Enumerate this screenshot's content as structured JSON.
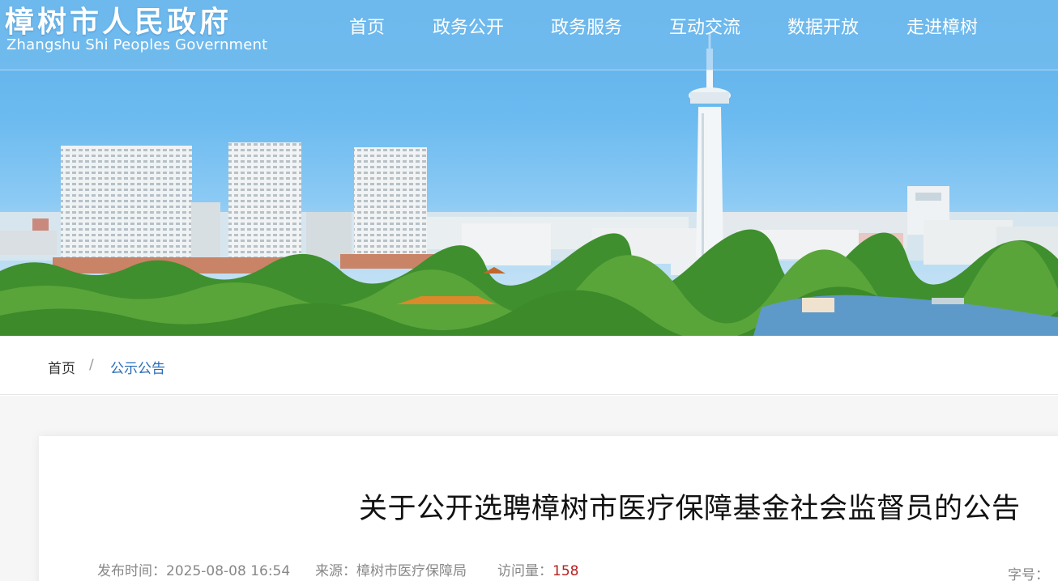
{
  "site": {
    "title_cn": "樟树市人民政府",
    "title_en": "Zhangshu Shi  Peoples Government"
  },
  "nav": {
    "items": [
      {
        "label": "首页"
      },
      {
        "label": "政务公开"
      },
      {
        "label": "政务服务"
      },
      {
        "label": "互动交流"
      },
      {
        "label": "数据开放"
      },
      {
        "label": "走进樟树"
      }
    ]
  },
  "breadcrumb": {
    "home": "首页",
    "separator": "/",
    "current": "公示公告"
  },
  "article": {
    "title": "关于公开选聘樟树市医疗保障基金社会监督员的公告",
    "publish_label": "发布时间：",
    "publish_time": "2025-08-08 16:54",
    "source_label": "来源：",
    "source": "樟树市医疗保障局",
    "views_label": "访问量：",
    "views": "158",
    "font_size_label": "字号："
  },
  "colors": {
    "accent_link": "#2a6db8",
    "views_count": "#b71c1c",
    "sky": "#6bbaf0"
  },
  "banner": {
    "description_icon": "city-skyline-image"
  }
}
